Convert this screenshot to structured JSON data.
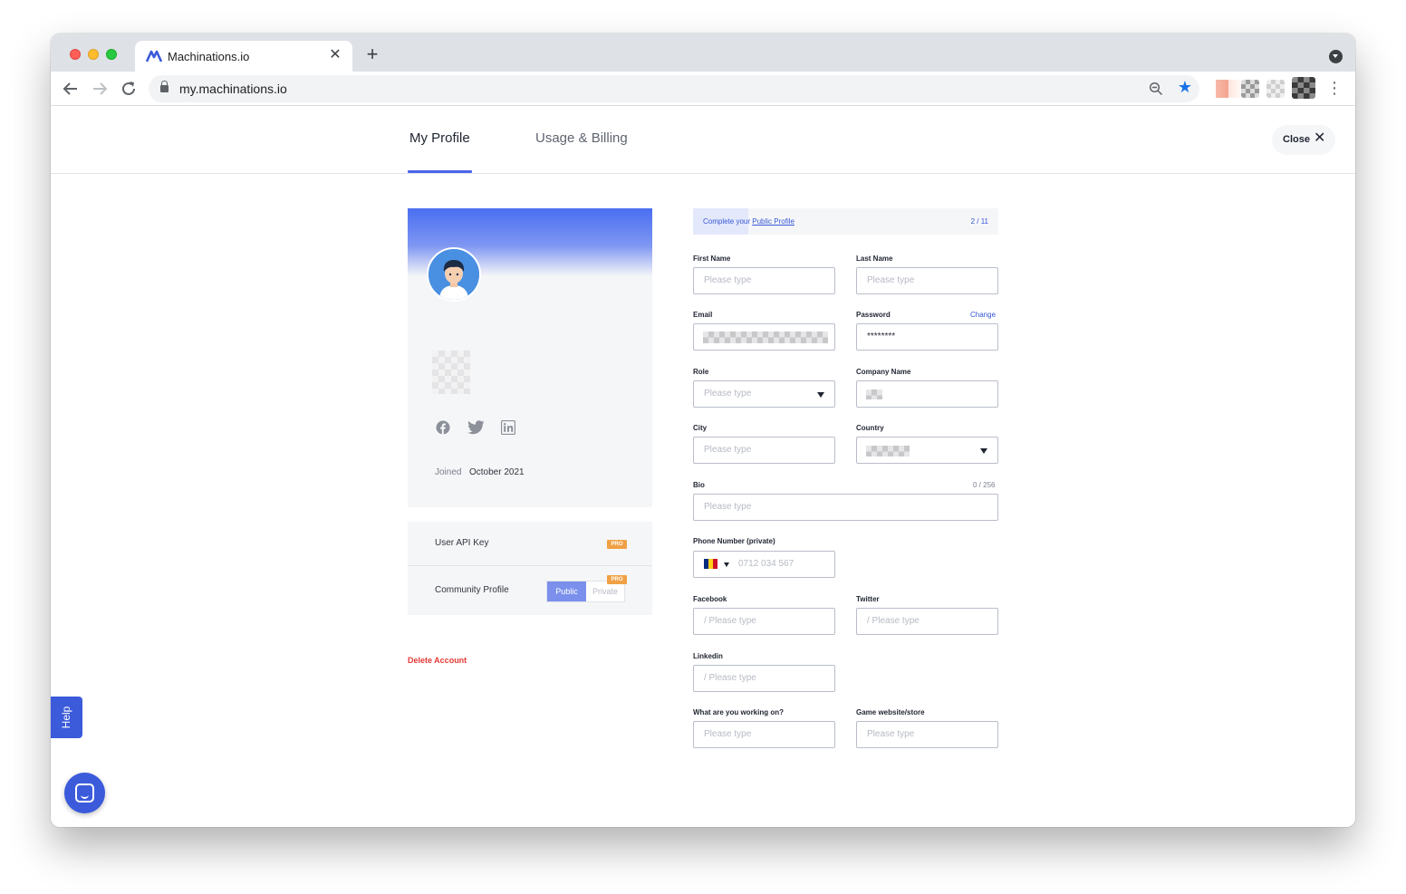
{
  "browser": {
    "tab_title": "Machinations.io",
    "url": "my.machinations.io",
    "tab_close": "✕",
    "new_tab": "+"
  },
  "header": {
    "tabs": [
      {
        "label": "My Profile",
        "active": true
      },
      {
        "label": "Usage & Billing",
        "active": false
      }
    ],
    "close_label": "Close",
    "accent_color": "#4a66e8"
  },
  "profile_card": {
    "joined_label": "Joined",
    "joined_value": "October 2021",
    "social_icons": [
      "facebook-icon",
      "twitter-icon",
      "linkedin-icon"
    ]
  },
  "settings": {
    "api_key_label": "User API Key",
    "pro_badge": "PRO",
    "community_label": "Community Profile",
    "public_label": "Public",
    "private_label": "Private",
    "visibility": "Public"
  },
  "delete_account": "Delete Account",
  "progress": {
    "text": "Complete your",
    "link": "Public Profile",
    "count": "2 / 11",
    "fraction": 0.18
  },
  "form": {
    "first_name": {
      "label": "First Name",
      "placeholder": "Please type"
    },
    "last_name": {
      "label": "Last Name",
      "placeholder": "Please type"
    },
    "email": {
      "label": "Email"
    },
    "password": {
      "label": "Password",
      "value": "********",
      "change": "Change"
    },
    "role": {
      "label": "Role",
      "placeholder": "Please type"
    },
    "company": {
      "label": "Company Name"
    },
    "city": {
      "label": "City",
      "placeholder": "Please type"
    },
    "country": {
      "label": "Country"
    },
    "bio": {
      "label": "Bio",
      "placeholder": "Please type",
      "counter": "0 / 256"
    },
    "phone": {
      "label": "Phone Number (private)",
      "placeholder": "0712 034 567"
    },
    "facebook": {
      "label": "Facebook",
      "placeholder": "/ Please type"
    },
    "twitter": {
      "label": "Twitter",
      "placeholder": "/ Please type"
    },
    "linkedin": {
      "label": "Linkedin",
      "placeholder": "/ Please type"
    },
    "working_on": {
      "label": "What are you working on?",
      "placeholder": "Please type"
    },
    "website": {
      "label": "Game website/store",
      "placeholder": "Please type"
    }
  },
  "help": {
    "label": "Help"
  }
}
